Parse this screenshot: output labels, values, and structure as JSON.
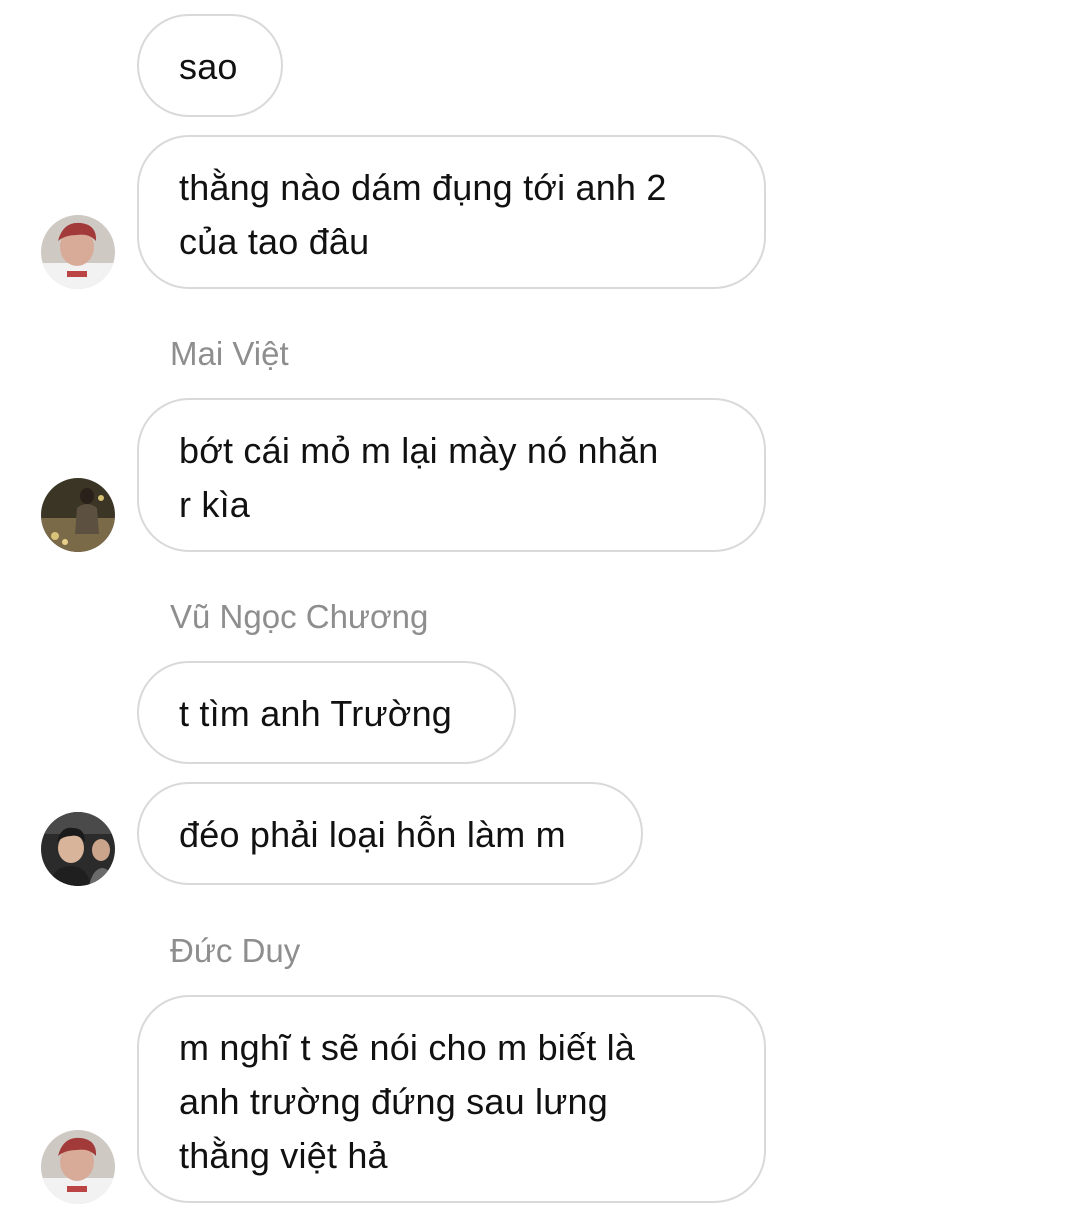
{
  "messages": [
    {
      "text": "sao"
    },
    {
      "text": "thằng nào dám đụng tới anh 2\ncủa tao đâu"
    },
    {
      "sender": "Mai Việt",
      "text": "bớt cái mỏ m lại mày nó nhăn\nr kìa"
    },
    {
      "sender": "Vũ Ngọc Chương",
      "text": "t tìm anh Trường"
    },
    {
      "text": "đéo phải loại hỗn làm m"
    },
    {
      "sender": "Đức Duy",
      "text": "m nghĩ t sẽ nói cho m biết là\nanh trường đứng sau lưng\nthằng việt hả"
    }
  ],
  "avatars": [
    {
      "icon": "user-avatar-icon",
      "color": "#b9877a"
    },
    {
      "icon": "user-avatar-icon",
      "color": "#6b5a3a"
    },
    {
      "icon": "user-avatar-icon",
      "color": "#3a3a3a"
    },
    {
      "icon": "user-avatar-icon",
      "color": "#b9877a"
    }
  ]
}
